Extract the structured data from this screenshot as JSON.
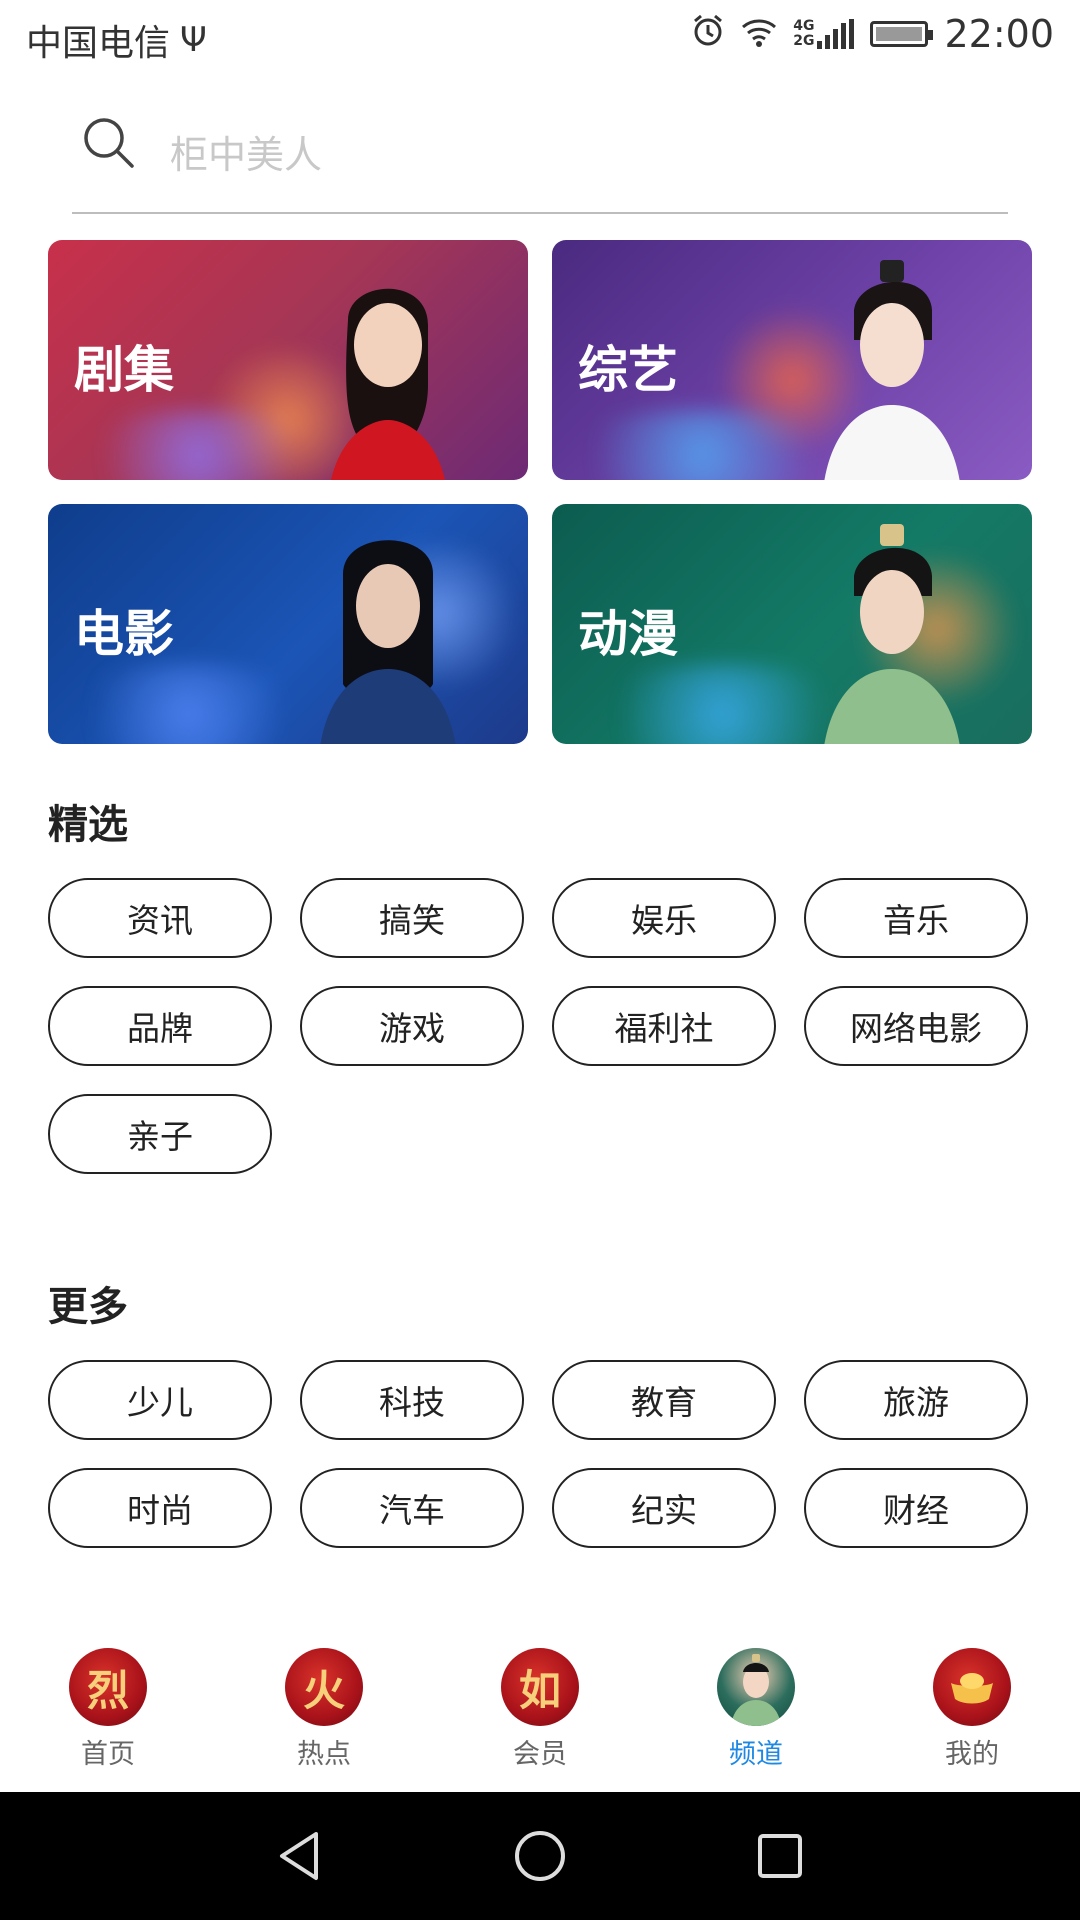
{
  "status_bar": {
    "carrier": "中国电信",
    "usb_icon": "usb-icon",
    "network": "4G\n2G",
    "time": "22:00"
  },
  "search": {
    "placeholder": "柜中美人"
  },
  "categories": [
    {
      "label": "剧集"
    },
    {
      "label": "综艺"
    },
    {
      "label": "电影"
    },
    {
      "label": "动漫"
    }
  ],
  "featured": {
    "title": "精选",
    "tags": [
      "资讯",
      "搞笑",
      "娱乐",
      "音乐",
      "品牌",
      "游戏",
      "福利社",
      "网络电影",
      "亲子"
    ]
  },
  "more": {
    "title": "更多",
    "tags": [
      "少儿",
      "科技",
      "教育",
      "旅游",
      "时尚",
      "汽车",
      "纪实",
      "财经"
    ]
  },
  "bottom_nav": {
    "items": [
      {
        "label": "首页",
        "glyph": "烈"
      },
      {
        "label": "热点",
        "glyph": "火"
      },
      {
        "label": "会员",
        "glyph": "如"
      },
      {
        "label": "频道",
        "glyph": ""
      },
      {
        "label": "我的",
        "glyph": ""
      }
    ],
    "active_index": 3,
    "active_color": "#1e88e5"
  }
}
